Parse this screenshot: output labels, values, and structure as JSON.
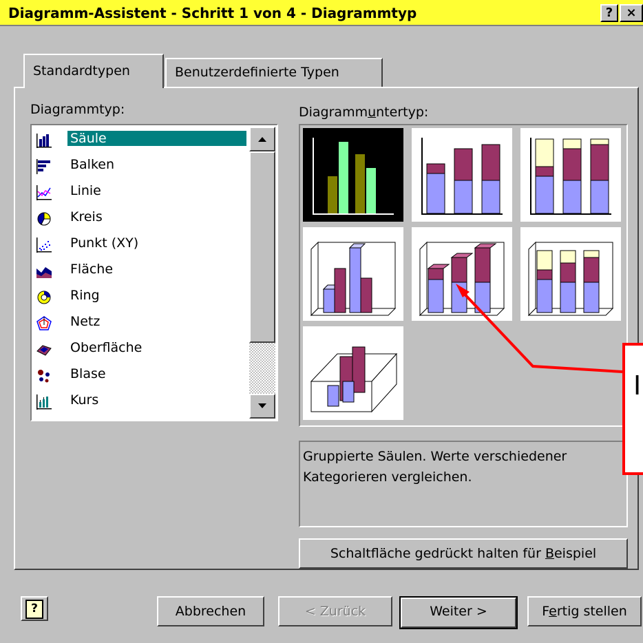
{
  "window": {
    "title": "Diagramm-Assistent - Schritt 1 von 4 - Diagrammtyp",
    "help_btn": "?",
    "close_btn": "×",
    "title_bg": "#ffff33"
  },
  "tabs": [
    {
      "label": "Standardtypen",
      "active": true
    },
    {
      "label": "Benutzerdefinierte Typen",
      "active": false
    }
  ],
  "chart_type": {
    "label_pre": "Dia",
    "label_ul": "g",
    "label_post": "rammtyp:",
    "items": [
      {
        "label": "Säule",
        "icon": "column-chart-icon",
        "selected": true
      },
      {
        "label": "Balken",
        "icon": "bar-chart-icon"
      },
      {
        "label": "Linie",
        "icon": "line-chart-icon"
      },
      {
        "label": "Kreis",
        "icon": "pie-chart-icon"
      },
      {
        "label": "Punkt (XY)",
        "icon": "scatter-chart-icon"
      },
      {
        "label": "Fläche",
        "icon": "area-chart-icon"
      },
      {
        "label": "Ring",
        "icon": "ring-chart-icon"
      },
      {
        "label": "Netz",
        "icon": "radar-chart-icon"
      },
      {
        "label": "Oberfläche",
        "icon": "surface-chart-icon"
      },
      {
        "label": "Blase",
        "icon": "bubble-chart-icon"
      },
      {
        "label": "Kurs",
        "icon": "stock-chart-icon"
      }
    ]
  },
  "subtype": {
    "label_pre": "Diagramm",
    "label_ul": "u",
    "label_post": "ntertyp:",
    "subtypes": [
      "clustered-column-icon",
      "stacked-column-icon",
      "percent-stacked-column-icon",
      "3d-clustered-column-icon",
      "3d-stacked-column-icon",
      "3d-percent-stacked-column-icon",
      "3d-column-icon"
    ],
    "description": "Gruppierte Säulen. Werte verschiedener Kategorieren vergleichen."
  },
  "buttons": {
    "example_pre": "Schaltfläche gedrückt halten für ",
    "example_ul": "B",
    "example_post": "eispiel",
    "help": "?",
    "cancel": "Abbrechen",
    "back": "< Zurück",
    "next": "Weiter >",
    "finish_pre": "F",
    "finish_ul": "e",
    "finish_post": "rtig stellen"
  },
  "annotation": {
    "color": "#ff0000",
    "text": "I"
  },
  "colors": {
    "selection": "#008080",
    "bar_purple": "#993366",
    "bar_blue": "#9999ff",
    "bar_yellow": "#ffffcc",
    "bar_olive": "#808000",
    "bar_green": "#80ffa0"
  }
}
